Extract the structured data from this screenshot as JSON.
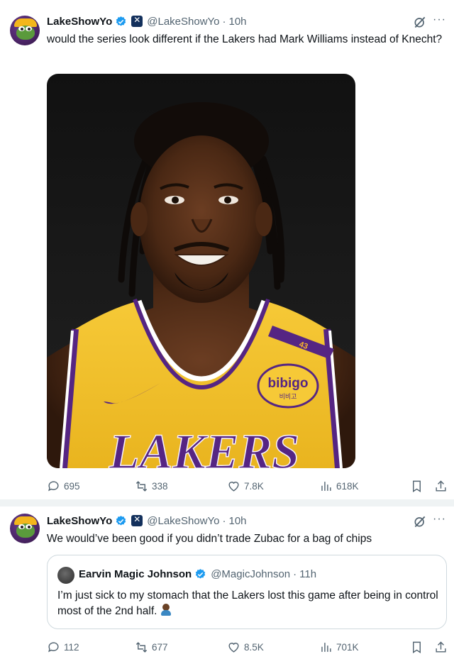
{
  "tweets": [
    {
      "author": {
        "name": "LakeShowYo",
        "handle": "@LakeShowYo",
        "time": "10h"
      },
      "text": "would the series look different if the Lakers had Mark Williams instead of Knecht?",
      "media": {
        "jersey_text": "LAKERS",
        "sponsor_patch": "bibigo",
        "sponsor_patch_sub": "비비고",
        "jersey_number": "43"
      },
      "stats": {
        "replies": "695",
        "reposts": "338",
        "likes": "7.8K",
        "views": "618K"
      }
    },
    {
      "author": {
        "name": "LakeShowYo",
        "handle": "@LakeShowYo",
        "time": "10h"
      },
      "text": "We would’ve been good if you didn’t trade Zubac for a bag of chips",
      "quote": {
        "author": {
          "name": "Earvin Magic Johnson",
          "handle": "@MagicJohnson",
          "time": "11h"
        },
        "text": "I’m just sick to my stomach that the Lakers lost this game after being in control most of the 2nd half."
      },
      "stats": {
        "replies": "112",
        "reposts": "677",
        "likes": "8.5K",
        "views": "701K"
      }
    }
  ],
  "ui": {
    "separator_dot": "·",
    "more_label": "···"
  },
  "colors": {
    "verified": "#1d9bf0",
    "secondary_text": "#536471",
    "border": "#cfd9de",
    "lakers_gold": "#fdb927",
    "lakers_purple": "#552583"
  }
}
